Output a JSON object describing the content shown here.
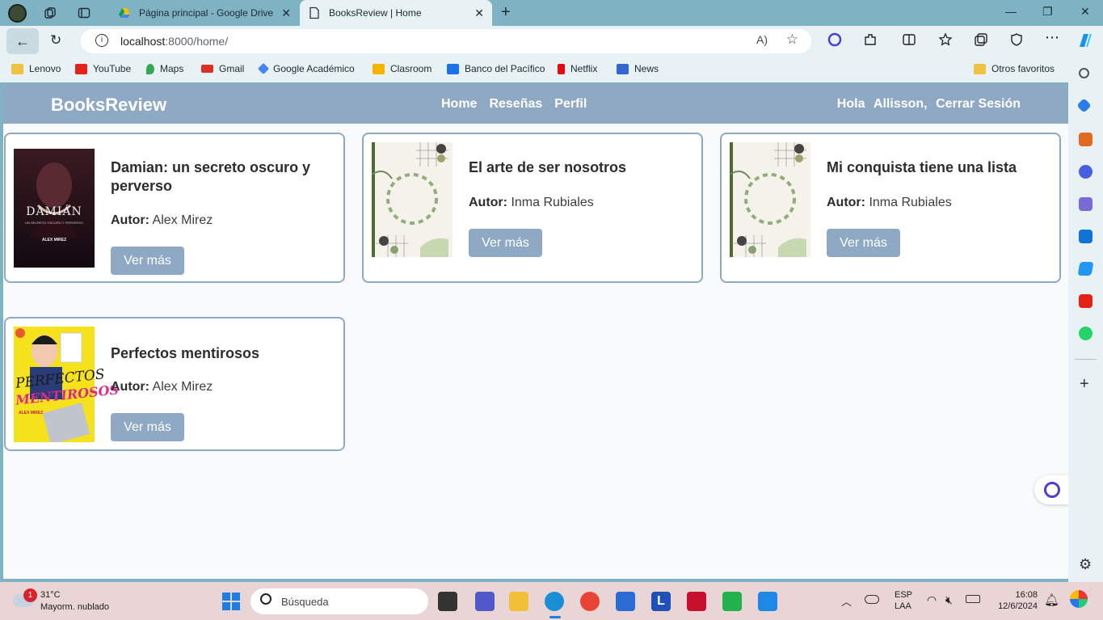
{
  "browser": {
    "tabs": [
      {
        "title": "Página principal - Google Drive"
      },
      {
        "title": "BooksReview | Home"
      }
    ],
    "url_host": "localhost",
    "url_path": ":8000/home/",
    "bookmarks": [
      {
        "label": "Lenovo",
        "color": "#f0c040"
      },
      {
        "label": "YouTube",
        "color": "#e62117"
      },
      {
        "label": "Maps",
        "color": "#34a853"
      },
      {
        "label": "Gmail",
        "color": "#d93025"
      },
      {
        "label": "Google Académico",
        "color": "#4285f4"
      },
      {
        "label": "Clasroom",
        "color": "#f5b400"
      },
      {
        "label": "Banco del Pacífico",
        "color": "#1a73e8"
      },
      {
        "label": "Netflix",
        "color": "#e50914"
      },
      {
        "label": "News",
        "color": "#3367d6"
      }
    ],
    "other_favorites": "Otros favoritos"
  },
  "app": {
    "brand": "BooksReview",
    "nav": [
      "Home",
      "Reseñas",
      "Perfil"
    ],
    "greeting": "Hola",
    "user": "Allisson,",
    "logout": "Cerrar Sesión",
    "accent": "#8fa9c4",
    "author_label": "Autor:",
    "more_label": "Ver más",
    "books": [
      {
        "title": "Damian: un secreto oscuro y perverso",
        "author": "Alex Mirez"
      },
      {
        "title": "El arte de ser nosotros",
        "author": "Inma Rubiales"
      },
      {
        "title": "Mi conquista tiene una lista",
        "author": "Inma Rubiales"
      },
      {
        "title": "Perfectos mentirosos",
        "author": "Alex Mirez"
      }
    ],
    "covers": {
      "damian": {
        "title": "DAMIÁN",
        "subtitle": "UN SECRETO OSCURO Y PERVERSO",
        "author": "ALEX MIREZ"
      },
      "perfectos": {
        "title1": "PERFECTOS",
        "title2": "MENTIROSOS",
        "author": "ALEX MIREZ"
      }
    }
  },
  "taskbar": {
    "temp": "31°C",
    "weather": "Mayorm. nublado",
    "weather_badge": "1",
    "search": "Búsqueda",
    "lang1": "ESP",
    "lang2": "LAA",
    "time": "16:08",
    "date": "12/6/2024"
  }
}
